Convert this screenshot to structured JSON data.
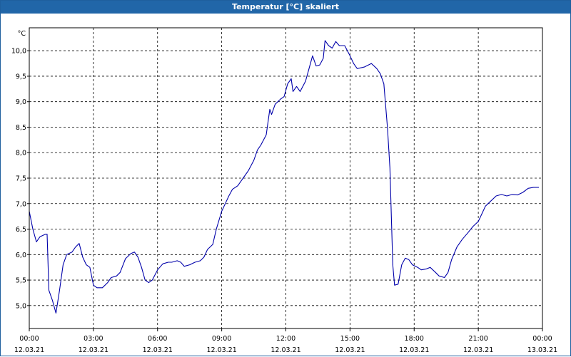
{
  "window": {
    "title": "Temperatur [°C] skaliert"
  },
  "chart_data": {
    "type": "line",
    "title": "Temperatur [°C] skaliert",
    "ylabel": "°C",
    "xlabel": "",
    "ylim": [
      4.55,
      10.45
    ],
    "xlim_hours": [
      0,
      24
    ],
    "grid": true,
    "yticks": [
      "5,0",
      "5,5",
      "6,0",
      "6,5",
      "7,0",
      "7,5",
      "8,0",
      "8,5",
      "9,0",
      "9,5",
      "10,0"
    ],
    "xticks": [
      {
        "time": "00:00",
        "date": "12.03.21"
      },
      {
        "time": "03:00",
        "date": "12.03.21"
      },
      {
        "time": "06:00",
        "date": "12.03.21"
      },
      {
        "time": "09:00",
        "date": "12.03.21"
      },
      {
        "time": "12:00",
        "date": "12.03.21"
      },
      {
        "time": "15:00",
        "date": "12.03.21"
      },
      {
        "time": "18:00",
        "date": "12.03.21"
      },
      {
        "time": "21:00",
        "date": "12.03.21"
      },
      {
        "time": "00:00",
        "date": "13.03.21"
      }
    ],
    "series": [
      {
        "color": "#0000aa",
        "points": [
          [
            "12.03.21 00:00",
            6.85
          ],
          [
            "12.03.21 00:10",
            6.5
          ],
          [
            "12.03.21 00:20",
            6.25
          ],
          [
            "12.03.21 00:30",
            6.35
          ],
          [
            "12.03.21 00:45",
            6.4
          ],
          [
            "12.03.21 00:50",
            6.4
          ],
          [
            "12.03.21 00:55",
            5.3
          ],
          [
            "12.03.21 01:05",
            5.1
          ],
          [
            "12.03.21 01:15",
            4.85
          ],
          [
            "12.03.21 01:25",
            5.3
          ],
          [
            "12.03.21 01:35",
            5.8
          ],
          [
            "12.03.21 01:45",
            6.0
          ],
          [
            "12.03.21 02:00",
            6.05
          ],
          [
            "12.03.21 02:10",
            6.15
          ],
          [
            "12.03.21 02:20",
            6.22
          ],
          [
            "12.03.21 02:30",
            5.95
          ],
          [
            "12.03.21 02:40",
            5.8
          ],
          [
            "12.03.21 02:50",
            5.75
          ],
          [
            "12.03.21 03:00",
            5.4
          ],
          [
            "12.03.21 03:10",
            5.35
          ],
          [
            "12.03.21 03:25",
            5.35
          ],
          [
            "12.03.21 03:40",
            5.45
          ],
          [
            "12.03.21 03:50",
            5.55
          ],
          [
            "12.03.21 04:05",
            5.58
          ],
          [
            "12.03.21 04:15",
            5.65
          ],
          [
            "12.03.21 04:30",
            5.92
          ],
          [
            "12.03.21 04:45",
            6.02
          ],
          [
            "12.03.21 04:55",
            6.05
          ],
          [
            "12.03.21 05:05",
            5.95
          ],
          [
            "12.03.21 05:15",
            5.75
          ],
          [
            "12.03.21 05:25",
            5.5
          ],
          [
            "12.03.21 05:35",
            5.45
          ],
          [
            "12.03.21 05:45",
            5.5
          ],
          [
            "12.03.21 06:00",
            5.7
          ],
          [
            "12.03.21 06:15",
            5.82
          ],
          [
            "12.03.21 06:30",
            5.85
          ],
          [
            "12.03.21 06:40",
            5.85
          ],
          [
            "12.03.21 06:55",
            5.88
          ],
          [
            "12.03.21 07:05",
            5.85
          ],
          [
            "12.03.21 07:15",
            5.77
          ],
          [
            "12.03.21 07:30",
            5.8
          ],
          [
            "12.03.21 07:45",
            5.85
          ],
          [
            "12.03.21 08:00",
            5.88
          ],
          [
            "12.03.21 08:10",
            5.95
          ],
          [
            "12.03.21 08:20",
            6.1
          ],
          [
            "12.03.21 08:35",
            6.2
          ],
          [
            "12.03.21 08:45",
            6.5
          ],
          [
            "12.03.21 09:00",
            6.85
          ],
          [
            "12.03.21 09:10",
            7.0
          ],
          [
            "12.03.21 09:20",
            7.15
          ],
          [
            "12.03.21 09:30",
            7.28
          ],
          [
            "12.03.21 09:45",
            7.35
          ],
          [
            "12.03.21 10:00",
            7.5
          ],
          [
            "12.03.21 10:15",
            7.65
          ],
          [
            "12.03.21 10:30",
            7.85
          ],
          [
            "12.03.21 10:40",
            8.05
          ],
          [
            "12.03.21 10:50",
            8.15
          ],
          [
            "12.03.21 11:05",
            8.35
          ],
          [
            "12.03.21 11:15",
            8.85
          ],
          [
            "12.03.21 11:20",
            8.75
          ],
          [
            "12.03.21 11:30",
            8.95
          ],
          [
            "12.03.21 11:45",
            9.05
          ],
          [
            "12.03.21 11:55",
            9.1
          ],
          [
            "12.03.21 12:05",
            9.35
          ],
          [
            "12.03.21 12:15",
            9.45
          ],
          [
            "12.03.21 12:20",
            9.2
          ],
          [
            "12.03.21 12:30",
            9.3
          ],
          [
            "12.03.21 12:40",
            9.2
          ],
          [
            "12.03.21 12:55",
            9.4
          ],
          [
            "12.03.21 13:05",
            9.65
          ],
          [
            "12.03.21 13:15",
            9.9
          ],
          [
            "12.03.21 13:25",
            9.7
          ],
          [
            "12.03.21 13:35",
            9.72
          ],
          [
            "12.03.21 13:45",
            9.85
          ],
          [
            "12.03.21 13:50",
            10.2
          ],
          [
            "12.03.21 14:00",
            10.1
          ],
          [
            "12.03.21 14:10",
            10.05
          ],
          [
            "12.03.21 14:20",
            10.18
          ],
          [
            "12.03.21 14:30",
            10.1
          ],
          [
            "12.03.21 14:45",
            10.1
          ],
          [
            "12.03.21 15:00",
            9.9
          ],
          [
            "12.03.21 15:10",
            9.75
          ],
          [
            "12.03.21 15:20",
            9.65
          ],
          [
            "12.03.21 15:40",
            9.68
          ],
          [
            "12.03.21 16:00",
            9.75
          ],
          [
            "12.03.21 16:15",
            9.65
          ],
          [
            "12.03.21 16:25",
            9.55
          ],
          [
            "12.03.21 16:35",
            9.35
          ],
          [
            "12.03.21 16:45",
            8.5
          ],
          [
            "12.03.21 16:52",
            7.7
          ],
          [
            "12.03.21 17:00",
            5.8
          ],
          [
            "12.03.21 17:05",
            5.4
          ],
          [
            "12.03.21 17:15",
            5.42
          ],
          [
            "12.03.21 17:25",
            5.8
          ],
          [
            "12.03.21 17:35",
            5.93
          ],
          [
            "12.03.21 17:45",
            5.9
          ],
          [
            "12.03.21 17:55",
            5.8
          ],
          [
            "12.03.21 18:10",
            5.75
          ],
          [
            "12.03.21 18:20",
            5.7
          ],
          [
            "12.03.21 18:35",
            5.72
          ],
          [
            "12.03.21 18:45",
            5.75
          ],
          [
            "12.03.21 19:00",
            5.65
          ],
          [
            "12.03.21 19:10",
            5.58
          ],
          [
            "12.03.21 19:25",
            5.55
          ],
          [
            "12.03.21 19:35",
            5.65
          ],
          [
            "12.03.21 19:45",
            5.9
          ],
          [
            "12.03.21 20:00",
            6.15
          ],
          [
            "12.03.21 20:15",
            6.3
          ],
          [
            "12.03.21 20:30",
            6.42
          ],
          [
            "12.03.21 20:45",
            6.55
          ],
          [
            "12.03.21 21:00",
            6.65
          ],
          [
            "12.03.21 21:10",
            6.8
          ],
          [
            "12.03.21 21:20",
            6.95
          ],
          [
            "12.03.21 21:35",
            7.05
          ],
          [
            "12.03.21 21:50",
            7.15
          ],
          [
            "12.03.21 22:05",
            7.18
          ],
          [
            "12.03.21 22:20",
            7.15
          ],
          [
            "12.03.21 22:35",
            7.18
          ],
          [
            "12.03.21 22:50",
            7.17
          ],
          [
            "12.03.21 23:05",
            7.22
          ],
          [
            "12.03.21 23:20",
            7.3
          ],
          [
            "12.03.21 23:35",
            7.32
          ],
          [
            "12.03.21 23:50",
            7.32
          ]
        ]
      }
    ]
  }
}
